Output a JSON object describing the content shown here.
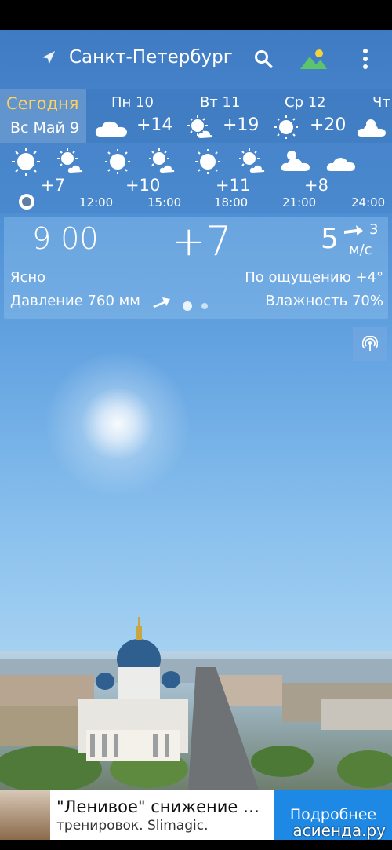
{
  "header": {
    "city": "Санкт-Петербург",
    "nav_icon": "location-arrow-icon",
    "search_icon": "search-icon",
    "scene_icon": "landscape-icon",
    "more_icon": "more-vert-icon"
  },
  "days": {
    "today_label": "Сегодня",
    "today_date": "Вс Май 9",
    "items": [
      {
        "name": "Пн 10",
        "temp": "+14",
        "icon": "cloud-icon"
      },
      {
        "name": "Вт 11",
        "temp": "+19",
        "icon": "sun-cloud-icon"
      },
      {
        "name": "Ср 12",
        "temp": "+20",
        "icon": "sun-icon"
      },
      {
        "name": "Чт",
        "temp": "",
        "icon": "sun-cloud-icon"
      }
    ]
  },
  "hourly": {
    "temps": [
      "+7",
      "+10",
      "+11",
      "+8"
    ],
    "times": [
      "12:00",
      "15:00",
      "18:00",
      "21:00",
      "24:00"
    ]
  },
  "current": {
    "time": "9  00",
    "temp": "+7",
    "wind_speed": "5",
    "wind_gust": "3",
    "wind_unit": "м/с",
    "condition": "Ясно",
    "feels_like": "По ощущению +4°",
    "pressure": "Давление 760 мм",
    "humidity": "Влажность 70%"
  },
  "ad": {
    "title": "\"Ленивое\" снижение веса",
    "subtitle": "тренировок. Slimagic.",
    "button": "Подробнее"
  },
  "watermark": "асиенда.ру",
  "colors": {
    "accent_today": "#ffd25e",
    "ad_button": "#1e88e5"
  }
}
